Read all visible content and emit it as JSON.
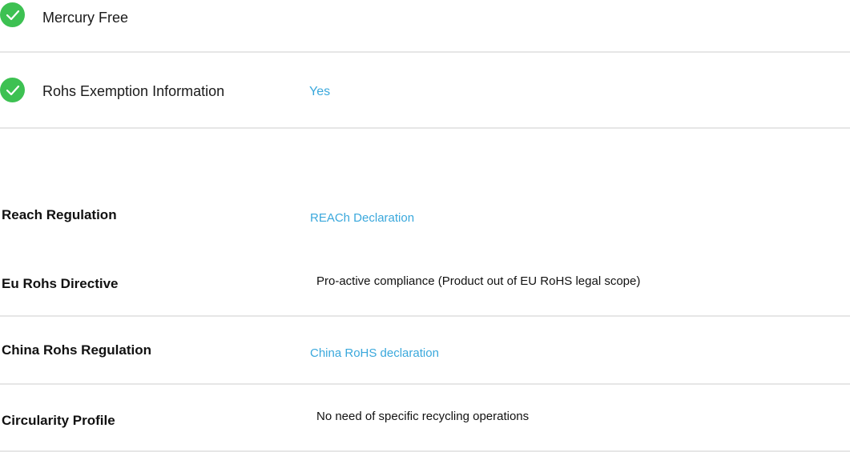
{
  "environment_items": [
    {
      "icon": "check-circle-icon",
      "label": "Mercury Free",
      "value": ""
    },
    {
      "icon": "check-circle-icon",
      "label": "Rohs Exemption Information",
      "value": "Yes"
    }
  ],
  "regulations": [
    {
      "label": "Reach Regulation",
      "value": "REACh Declaration",
      "is_link": true
    },
    {
      "label": "Eu Rohs Directive",
      "value": "Pro-active compliance (Product out of EU RoHS legal scope)",
      "is_link": false
    },
    {
      "label": "China Rohs Regulation",
      "value": "China RoHS declaration",
      "is_link": true
    },
    {
      "label": "Circularity Profile",
      "value": "No need of specific recycling operations",
      "is_link": false
    }
  ],
  "colors": {
    "check_green": "#3dc152",
    "link_blue": "#3aa8dc",
    "divider": "#e6e6e6"
  }
}
